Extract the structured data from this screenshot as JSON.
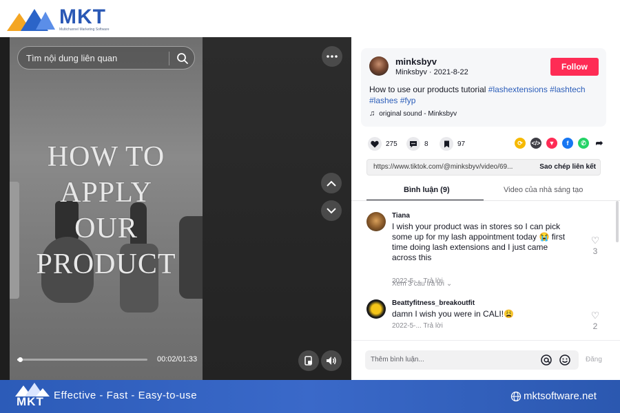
{
  "brand": {
    "name": "MKT",
    "subtitle": "Multichannel Marketing Software",
    "tagline": "Effective - Fast - Easy-to-use",
    "website": "mktsoftware.net"
  },
  "video": {
    "search_placeholder": "Tìm nội dung liên quan",
    "overlay_text": [
      "HOW TO",
      "APPLY",
      "OUR",
      "PRODUCT"
    ],
    "time": "00:02/01:33",
    "progress": 0.02
  },
  "post": {
    "username": "minksbyv",
    "meta": "Minksbyv · 2021-8-22",
    "follow_label": "Follow",
    "description_text": "How to use our products tutorial ",
    "hashtags": [
      "#lashextensions",
      "#lashtech",
      "#lashes",
      "#fyp"
    ],
    "sound": "original sound - Minksbyv",
    "likes": "275",
    "comments": "8",
    "saves": "97",
    "url": "https://www.tiktok.com/@minksbyv/video/69...",
    "copy_label": "Sao chép liên kết"
  },
  "tabs": {
    "comments": "Bình luận (9)",
    "creator_videos": "Video của nhà sáng tạo"
  },
  "comments": [
    {
      "user": "Tiana",
      "text": "I wish your product was in stores so I can pick some up for my lash appointment today 😭 first time doing lash extensions and I just came across this",
      "date": "2022-5-...",
      "reply": "Trả lời",
      "likes": "3",
      "view_replies": "Xem 3 câu trả lời"
    },
    {
      "user": "Beattyfitness_breakoutfit",
      "text": "damn I wish you were in CALI!😩",
      "date": "2022-5-...",
      "reply": "Trả lời",
      "likes": "2"
    }
  ],
  "comment_input": {
    "placeholder": "Thêm bình luận...",
    "post_label": "Đăng"
  },
  "colors": {
    "accent": "#fe2c55",
    "hashtag": "#2b5db9",
    "brand_blue": "#2a58b5",
    "brand_orange": "#f4a623"
  }
}
